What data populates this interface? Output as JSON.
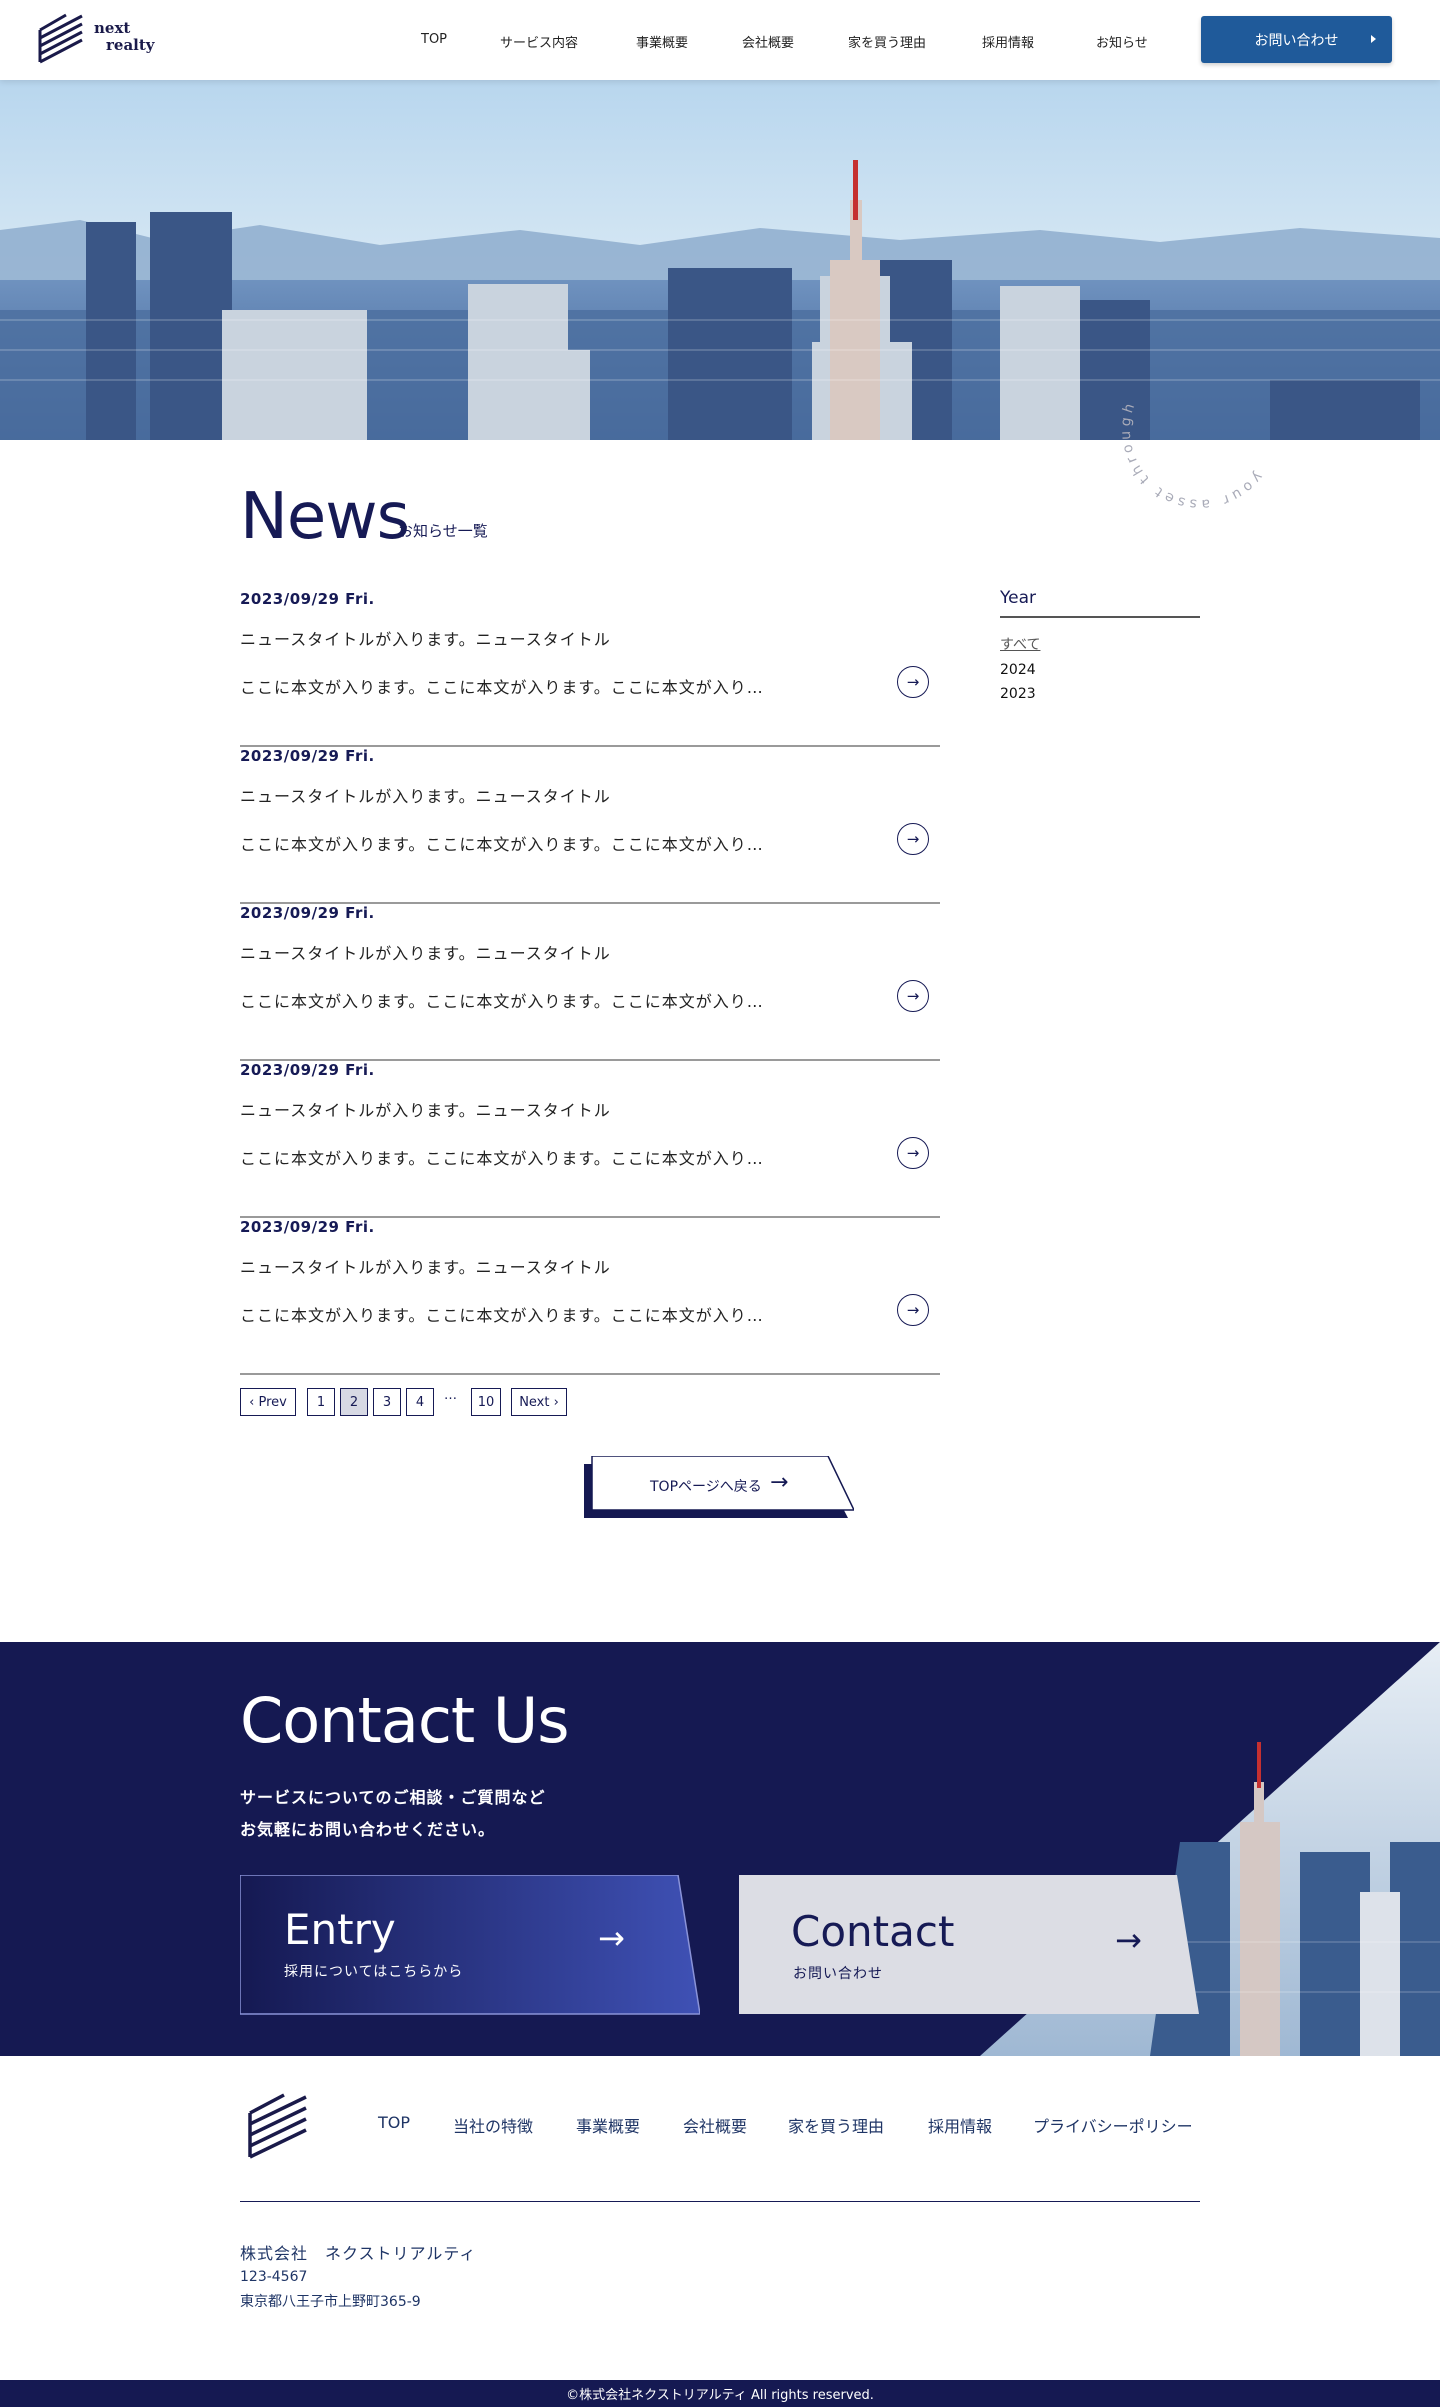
{
  "header": {
    "logo_line1": "next",
    "logo_line2": "realty",
    "nav": [
      "TOP",
      "サービス内容",
      "事業概要",
      "会社概要",
      "家を買う理由",
      "採用情報",
      "お知らせ"
    ],
    "contact_label": "お問い合わせ"
  },
  "hero": {
    "circle_text": "your asset through"
  },
  "news": {
    "title": "News",
    "subtitle": "お知らせ一覧",
    "items": [
      {
        "date": "2023/09/29 Fri.",
        "title": "ニュースタイトルが入ります。ニュースタイトル",
        "body": "ここに本文が入ります。ここに本文が入ります。ここに本文が入り…"
      },
      {
        "date": "2023/09/29 Fri.",
        "title": "ニュースタイトルが入ります。ニュースタイトル",
        "body": "ここに本文が入ります。ここに本文が入ります。ここに本文が入り…"
      },
      {
        "date": "2023/09/29 Fri.",
        "title": "ニュースタイトルが入ります。ニュースタイトル",
        "body": "ここに本文が入ります。ここに本文が入ります。ここに本文が入り…"
      },
      {
        "date": "2023/09/29 Fri.",
        "title": "ニュースタイトルが入ります。ニュースタイトル",
        "body": "ここに本文が入ります。ここに本文が入ります。ここに本文が入り…"
      },
      {
        "date": "2023/09/29 Fri.",
        "title": "ニュースタイトルが入ります。ニュースタイトル",
        "body": "ここに本文が入ります。ここに本文が入ります。ここに本文が入り…"
      }
    ],
    "arrow_glyph": "→"
  },
  "sidebar": {
    "title": "Year",
    "items": [
      "すべて",
      "2024",
      "2023"
    ]
  },
  "pagination": {
    "prev": "‹ Prev",
    "pages": [
      "1",
      "2",
      "3",
      "4"
    ],
    "dots": "…",
    "last": "10",
    "next": "Next ›",
    "current": "2"
  },
  "back_button": {
    "label": "TOPページへ戻る",
    "arrow": "→"
  },
  "contact": {
    "title": "Contact Us",
    "desc_line1": "サービスについてのご相談・ご質問など",
    "desc_line2": "お気軽にお問い合わせください。",
    "entry_title": "Entry",
    "entry_sub": "採用についてはこちらから",
    "contact_title": "Contact",
    "contact_sub": "お問い合わせ",
    "arrow": "→"
  },
  "footer": {
    "nav": [
      "TOP",
      "当社の特徴",
      "事業概要",
      "会社概要",
      "家を買う理由",
      "採用情報",
      "プライバシーポリシー"
    ],
    "company": "株式会社　ネクストリアルティ",
    "zip": "123-4567",
    "address": "東京都八王子市上野町365-9",
    "copyright": "©株式会社ネクストリアルティ All rights reserved."
  },
  "colors": {
    "navy": "#151952",
    "button_blue": "#1f5a9a",
    "entry_gradient_end": "#3f51b5",
    "contact_card": "#dcdde4"
  }
}
